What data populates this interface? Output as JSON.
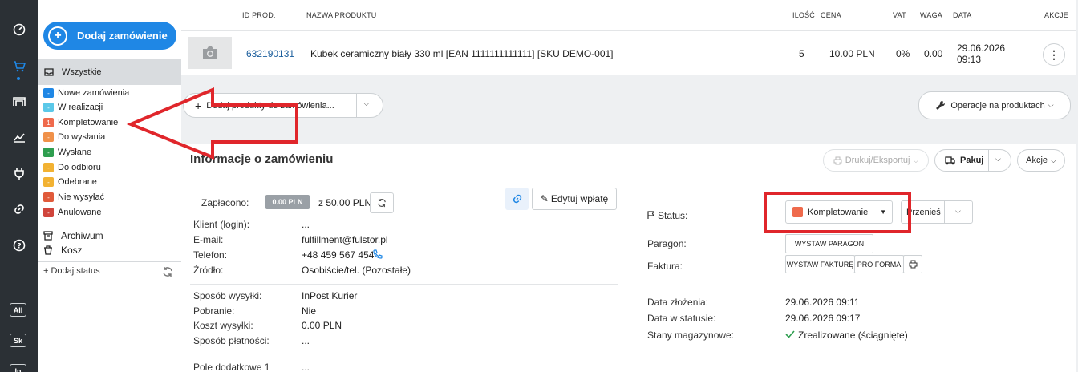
{
  "rail": {
    "items": [
      {
        "icon": "dashboard-icon"
      },
      {
        "icon": "cart-icon"
      },
      {
        "icon": "warehouse-icon"
      },
      {
        "icon": "chart-icon"
      },
      {
        "icon": "plug-icon"
      },
      {
        "icon": "link-icon"
      },
      {
        "icon": "help-icon"
      }
    ],
    "tags": [
      "All",
      "Sk",
      "In"
    ]
  },
  "sidebar": {
    "add_order": "Dodaj zamówienie",
    "all_label": "Wszystkie",
    "statuses": [
      {
        "label": "Nowe zamówienia",
        "color": "#1f87e5",
        "badge": "-"
      },
      {
        "label": "W realizacji",
        "color": "#5bc8e8",
        "badge": "-"
      },
      {
        "label": "Kompletowanie",
        "color": "#ef6a4c",
        "badge": "1"
      },
      {
        "label": "Do wysłania",
        "color": "#f0914a",
        "badge": "-"
      },
      {
        "label": "Wysłane",
        "color": "#2e9e4f",
        "badge": "-"
      },
      {
        "label": "Do odbioru",
        "color": "#f2b233",
        "badge": "-"
      },
      {
        "label": "Odebrane",
        "color": "#f2b233",
        "badge": "-"
      },
      {
        "label": "Nie wysyłać",
        "color": "#e05a3a",
        "badge": "-"
      },
      {
        "label": "Anulowane",
        "color": "#d0453c",
        "badge": "-"
      }
    ],
    "archive": "Archiwum",
    "trash": "Kosz",
    "add_status": "+ Dodaj status"
  },
  "products": {
    "headers": {
      "id": "ID PROD.",
      "name": "NAZWA PRODUKTU",
      "qty": "ILOŚĆ",
      "price": "CENA",
      "vat": "VAT",
      "weight": "WAGA",
      "date": "DATA",
      "actions": "AKCJE"
    },
    "row": {
      "id": "632190131",
      "name": "Kubek ceramiczny biały 330 ml [EAN 1111111111111] [SKU DEMO-001]",
      "qty": "5",
      "price": "10.00 PLN",
      "vat": "0%",
      "weight": "0.00",
      "date": "29.06.2026",
      "time": "09:13"
    },
    "add_products": "Dodaj produkty do zamówienia...",
    "operations": "Operacje na produktach"
  },
  "info": {
    "title": "Informacje o zamówieniu",
    "print_export": "Drukuj/Eksportuj",
    "pack": "Pakuj",
    "actions": "Akcje",
    "paid_label": "Zapłacono:",
    "paid_badge": "0.00 PLN",
    "paid_total": "z 50.00 PLN",
    "edit_payment": "Edytuj wpłatę",
    "client": [
      {
        "label": "Klient (login):",
        "value": "..."
      },
      {
        "label": "E-mail:",
        "value": "fulfillment@fulstor.pl"
      },
      {
        "label": "Telefon:",
        "value": "+48 459 567 454"
      },
      {
        "label": "Źródło:",
        "value": "Osobiście/tel. (Pozostałe)"
      }
    ],
    "shipping": [
      {
        "label": "Sposób wysyłki:",
        "value": "InPost Kurier"
      },
      {
        "label": "Pobranie:",
        "value": "Nie"
      },
      {
        "label": "Koszt wysyłki:",
        "value": "0.00 PLN"
      },
      {
        "label": "Sposób płatności:",
        "value": "..."
      }
    ],
    "extra": [
      {
        "label": "Pole dodatkowe 1",
        "value": "..."
      }
    ],
    "status_label": "Status:",
    "status_value": "Kompletowanie",
    "status_color": "#ef6a4c",
    "move_btn": "Przenieś",
    "receipt_label": "Paragon:",
    "receipt_btn": "WYSTAW PARAGON",
    "invoice_label": "Faktura:",
    "invoice_btn": "WYSTAW FAKTURĘ",
    "proforma_btn": "PRO FORMA",
    "dates": [
      {
        "label": "Data złożenia:",
        "value": "29.06.2026 09:11"
      },
      {
        "label": "Data w statusie:",
        "value": "29.06.2026 09:17"
      },
      {
        "label": "Stany magazynowe:",
        "value": "Zrealizowane (ściągnięte)"
      }
    ]
  },
  "annotation_color": "#e0262b"
}
